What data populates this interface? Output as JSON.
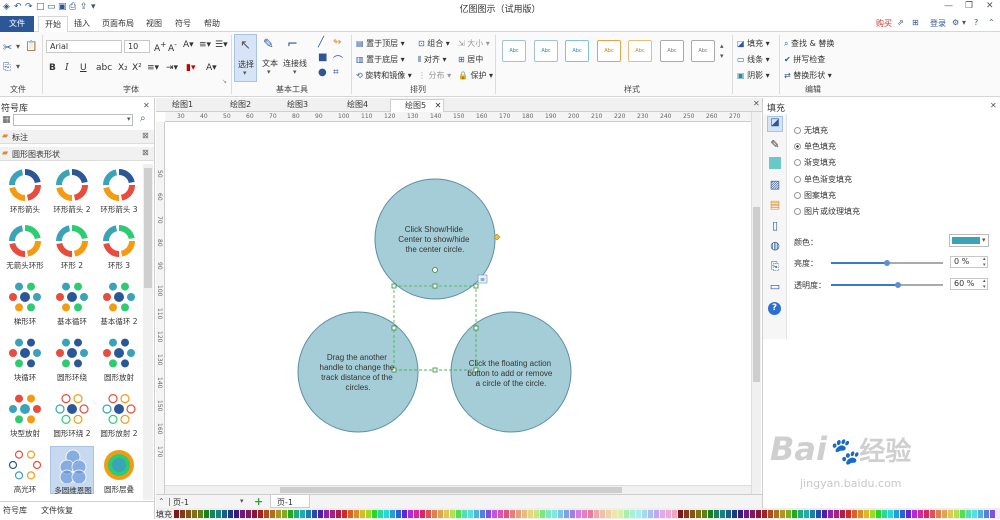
{
  "app": {
    "title": "亿图图示（试用版）",
    "buy_label": "购买",
    "login_label": "登录"
  },
  "menu": {
    "items": [
      "文件",
      "开始",
      "插入",
      "页面布局",
      "视图",
      "符号",
      "帮助"
    ],
    "active": "开始"
  },
  "ribbon": {
    "font_name": "Arial",
    "font_size": "10",
    "groups": [
      "文件",
      "字体",
      "基本工具",
      "排列",
      "样式",
      "编辑"
    ],
    "tools": {
      "select": "选择",
      "text": "文本",
      "connector": "连接线"
    },
    "arrange": {
      "bring_front": "置于顶层",
      "send_back": "置于底层",
      "rotate": "旋转和镜像",
      "group": "组合",
      "align": "对齐",
      "distribute": "分布",
      "size": "大小",
      "center": "居中",
      "protect": "保护"
    },
    "style_box_text": "Abc",
    "fill_items": [
      "填充",
      "线条",
      "阴影"
    ],
    "edit_items": [
      "查找 & 替换",
      "拼写检查",
      "替换形状"
    ]
  },
  "left_panel": {
    "title": "符号库",
    "search_placeholder": "",
    "section1": "标注",
    "section2": "圆形图表形状",
    "shapes": [
      "环形箭头",
      "环形箭头 2",
      "环形箭头 3",
      "无箭头环形",
      "环形 2",
      "环形 3",
      "梯形环",
      "基本循环",
      "基本循环 2",
      "块循环",
      "圆形环绕",
      "圆形放射",
      "块型放射",
      "圆形环绕 2",
      "圆形放射 2",
      "高光环",
      "多圆维恩图",
      "圆形层叠"
    ],
    "bottom_tabs": [
      "符号库",
      "文件恢复"
    ]
  },
  "doc_tabs": [
    "绘图1",
    "绘图2",
    "绘图3",
    "绘图4",
    "绘图5"
  ],
  "active_tab": "绘图5",
  "rulers": {
    "h_ticks": [
      "30",
      "40",
      "50",
      "60",
      "70",
      "80",
      "90",
      "100",
      "110",
      "120",
      "130",
      "140",
      "150",
      "160",
      "170",
      "180",
      "190",
      "200",
      "210",
      "220",
      "230",
      "240",
      "250",
      "260",
      "270"
    ],
    "v_ticks": [
      "50",
      "60",
      "70",
      "80",
      "90",
      "100",
      "110",
      "120",
      "130",
      "140",
      "150",
      "160",
      "170"
    ]
  },
  "canvas": {
    "circle_top_text": [
      "Click Show/Hide",
      "Center to show/hide",
      "the center circle."
    ],
    "circle_left_text": [
      "Drag the another",
      "handle to change the",
      "track distance of the",
      "circles."
    ],
    "circle_right_text": [
      "Click the floating action",
      "button to add or remove",
      "a circle of the circle."
    ],
    "circle_fill": "#a5cdd8",
    "circle_stroke": "#5a8fa0"
  },
  "page_bar": {
    "page_label": "页-1",
    "page_tab": "页-1",
    "fill_label": "填充"
  },
  "right_panel": {
    "title": "填充",
    "options": [
      "无填充",
      "单色填充",
      "渐变填充",
      "单色渐变填充",
      "图案填充",
      "图片或纹理填充"
    ],
    "selected_option": "单色填充",
    "color_label": "颜色：",
    "color_value": "#3aa3b8",
    "brightness_label": "亮度：",
    "brightness_value": "0 %",
    "transparency_label": "透明度：",
    "transparency_value": "60 %"
  },
  "watermark": {
    "brand": "Bai",
    "brand2": "经验",
    "url": "jingyan.baidu.com"
  }
}
